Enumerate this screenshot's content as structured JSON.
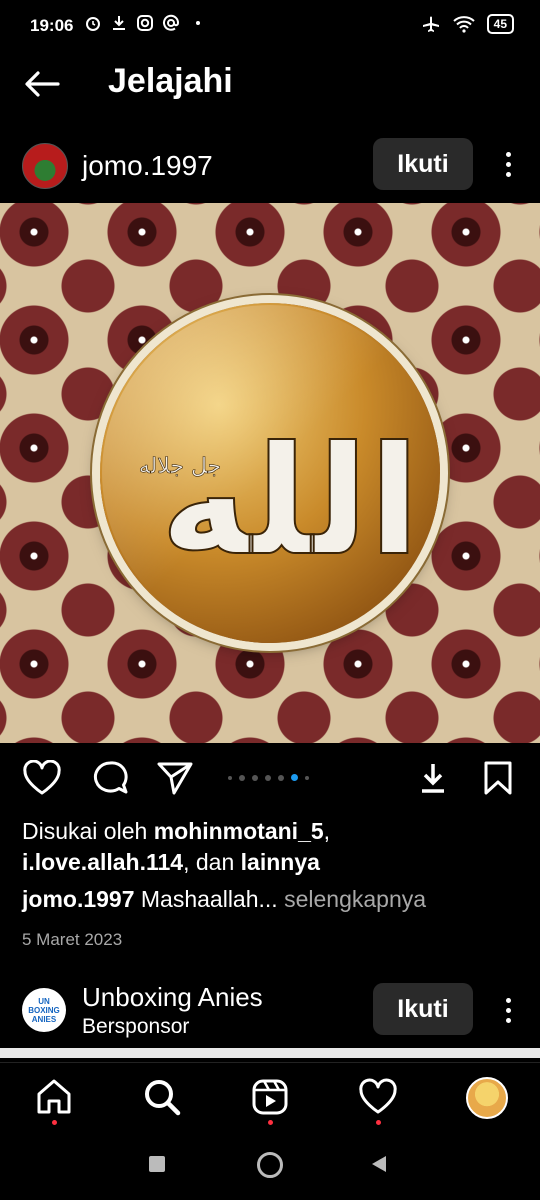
{
  "status_bar": {
    "time": "19:06",
    "left_icons": [
      "alarm-icon",
      "download-icon",
      "instagram-icon",
      "threads-icon",
      "dot-icon"
    ],
    "right_icons": [
      "airplane-mode-icon",
      "wifi-icon",
      "battery-icon"
    ],
    "battery": "45"
  },
  "header": {
    "title": "Jelajahi"
  },
  "post": {
    "username": "jomo.1997",
    "follow_label": "Ikuti",
    "image": {
      "calligraphy_main": "الله",
      "calligraphy_small": "جل جلاله"
    },
    "carousel": {
      "count": 7,
      "active_index": 5
    },
    "likes_prefix": "Disukai oleh ",
    "liker1": "mohinmotani_5",
    "likes_sep": ",",
    "liker2": "i.love.allah.114",
    "likes_mid": ", dan ",
    "likes_others": "lainnya",
    "caption_user": "jomo.1997",
    "caption_text": " Mashaallah...",
    "more_label": " selengkapnya",
    "date": "5 Maret 2023"
  },
  "sponsored": {
    "avatar_text": "UN BOXING ANIES",
    "name": "Unboxing Anies",
    "label": "Bersponsor",
    "follow_label": "Ikuti"
  },
  "colors": {
    "background": "#000000",
    "accent_blue": "#1d9bf0",
    "notification_red": "#ff3040",
    "button_bg": "#2a2a2a"
  }
}
